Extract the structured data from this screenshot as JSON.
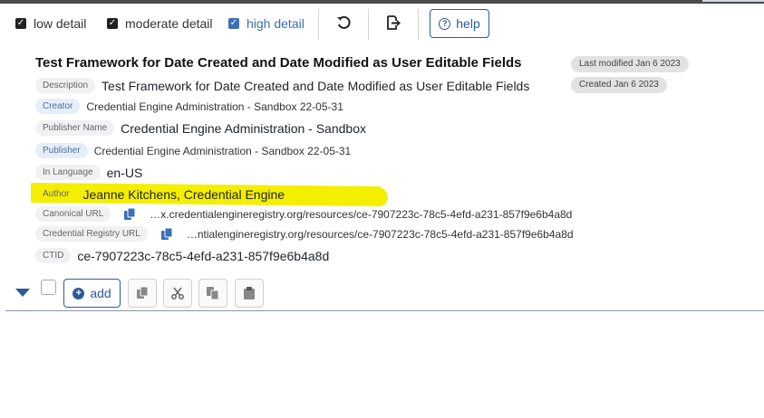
{
  "toolbar": {
    "low_detail": "low detail",
    "moderate_detail": "moderate detail",
    "high_detail": "high detail",
    "undo_icon": "undo-icon",
    "export_icon": "export-icon",
    "help": "help"
  },
  "record": {
    "title": "Test Framework for Date Created and Date Modified as User Editable Fields",
    "last_modified": "Last modified Jan 6 2023",
    "created": "Created Jan 6 2023",
    "fields": {
      "description_label": "Description",
      "description": "Test Framework for Date Created and Date Modified as User Editable Fields",
      "creator_label": "Creator",
      "creator": "Credential Engine Administration - Sandbox 22-05-31",
      "publisher_name_label": "Publisher Name",
      "publisher_name": "Credential Engine Administration - Sandbox",
      "publisher_label": "Publisher",
      "publisher": "Credential Engine Administration - Sandbox 22-05-31",
      "in_language_label": "In Language",
      "in_language": "en-US",
      "author_label": "Author",
      "author": "Jeanne Kitchens, Credential Engine",
      "canonical_url_label": "Canonical URL",
      "canonical_url": "…x.credentialengineregistry.org/resources/ce-7907223c-78c5-4efd-a231-857f9e6b4a8d",
      "registry_url_label": "Credential Registry URL",
      "registry_url": "…ntialengineregistry.org/resources/ce-7907223c-78c5-4efd-a231-857f9e6b4a8d",
      "ctid_label": "CTID",
      "ctid": "ce-7907223c-78c5-4efd-a231-857f9e6b4a8d"
    }
  },
  "actions": {
    "add": "add"
  },
  "colors": {
    "accent": "#2c5b9a",
    "highlight": "#f4ee00"
  }
}
